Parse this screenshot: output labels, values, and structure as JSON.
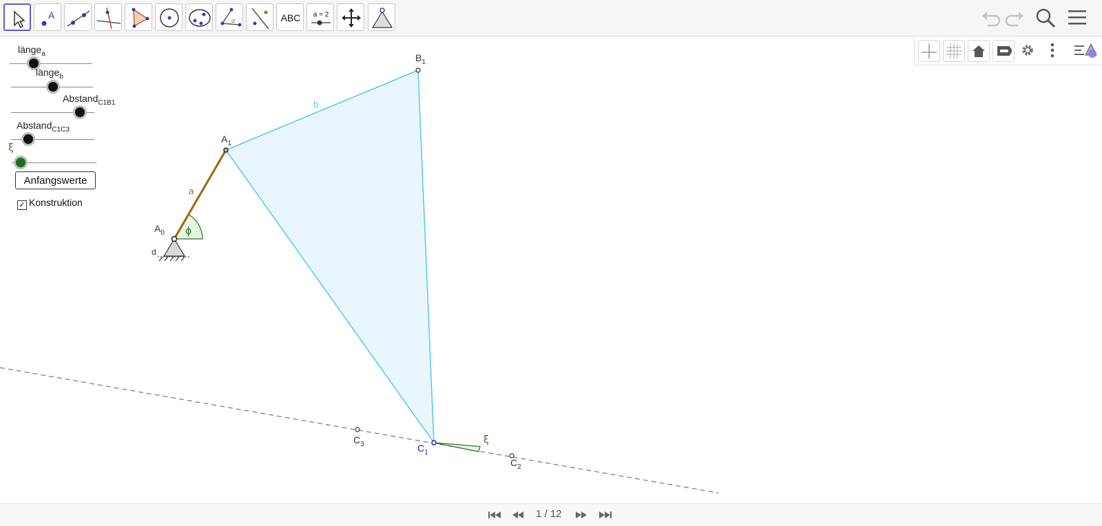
{
  "toolbar": {
    "tools": [
      {
        "name": "move-tool",
        "label": ""
      },
      {
        "name": "point-tool",
        "label": "A"
      },
      {
        "name": "line-tool",
        "label": ""
      },
      {
        "name": "perpendicular-tool",
        "label": ""
      },
      {
        "name": "polygon-tool",
        "label": ""
      },
      {
        "name": "circle-tool",
        "label": ""
      },
      {
        "name": "conic-tool",
        "label": ""
      },
      {
        "name": "angle-tool",
        "label": "α"
      },
      {
        "name": "reflect-tool",
        "label": ""
      },
      {
        "name": "text-tool",
        "label": "ABC"
      },
      {
        "name": "slider-tool",
        "label": "a = 2"
      },
      {
        "name": "move-view-tool",
        "label": ""
      },
      {
        "name": "custom-tool",
        "label": ""
      }
    ]
  },
  "sliders": [
    {
      "name": "länge",
      "sub": "a",
      "value": 0.18
    },
    {
      "name": "länge",
      "sub": "b",
      "value": 0.4
    },
    {
      "name": "Abstand",
      "sub": "C1B1",
      "value": 0.72
    },
    {
      "name": "Abstand",
      "sub": "C1C3",
      "value": 0.1
    },
    {
      "name": "ξ",
      "sub": "",
      "value": 0.0
    }
  ],
  "reset_button": "Anfangswerte",
  "konstruktion": {
    "label": "Konstruktion",
    "checked": true
  },
  "geometry_labels": {
    "A0": {
      "main": "A",
      "sub": "0"
    },
    "A1": {
      "main": "A",
      "sub": "1"
    },
    "B1": {
      "main": "B",
      "sub": "1"
    },
    "C1": {
      "main": "C",
      "sub": "1"
    },
    "C2": {
      "main": "C",
      "sub": "2"
    },
    "C3": {
      "main": "C",
      "sub": "3"
    },
    "segment_a": "a",
    "segment_b": "b",
    "angle_phi": "ϕ",
    "angle_xi": "ξ",
    "ground": "d"
  },
  "colors": {
    "accent": "#6557d2",
    "triangle_fill": "#eaf6fd",
    "triangle_stroke": "#55c7f0",
    "crank": "#a0650c",
    "angle_fill": "#e6f4e2",
    "angle_stroke": "#2e6f2e",
    "c1_blue": "#1b1bd6"
  },
  "footer": {
    "page": "1 / 12"
  }
}
